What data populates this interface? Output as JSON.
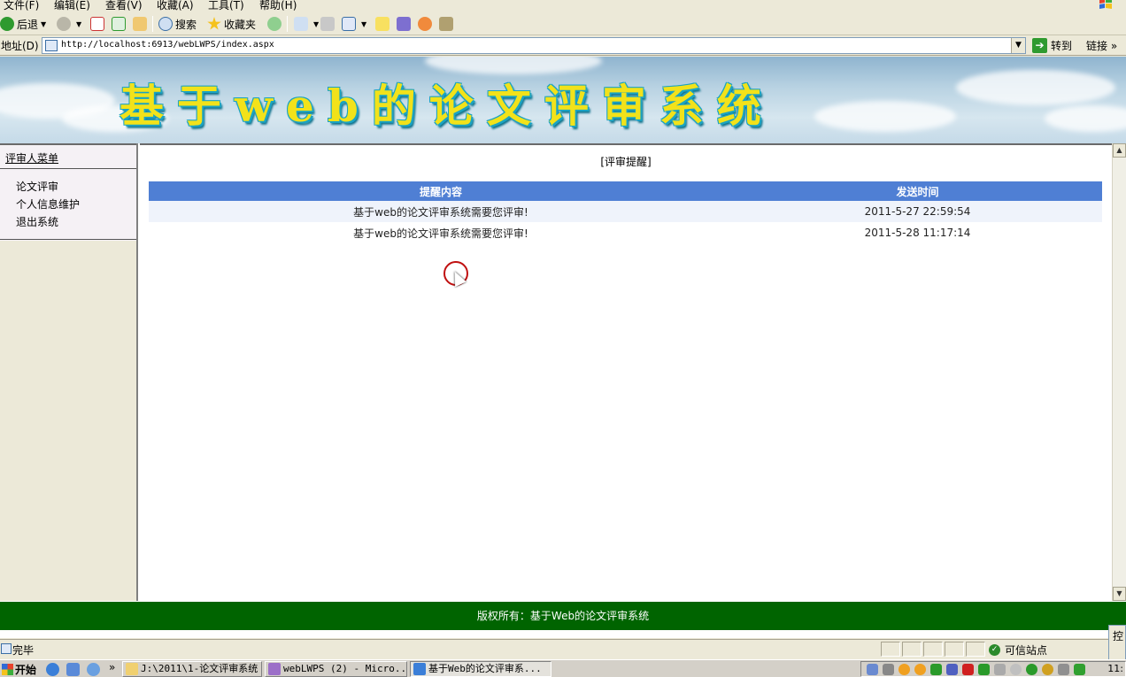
{
  "browser": {
    "menu": [
      "文件(F)",
      "编辑(E)",
      "查看(V)",
      "收藏(A)",
      "工具(T)",
      "帮助(H)"
    ],
    "toolbar": {
      "back_label": "后退",
      "search_label": "搜索",
      "favorites_label": "收藏夹"
    },
    "address": {
      "label": "地址(D)",
      "url": "http://localhost:6913/webLWPS/index.aspx",
      "go_label": "转到",
      "links_label": "链接"
    },
    "status": {
      "text": "完毕",
      "zone": "可信站点",
      "side_tab": "控"
    }
  },
  "page": {
    "banner_title": "基于web的论文评审系统",
    "sidebar": {
      "heading": "评审人菜单",
      "items": [
        {
          "label": "论文评审"
        },
        {
          "label": "个人信息维护"
        },
        {
          "label": "退出系统"
        }
      ]
    },
    "content": {
      "title": "[评审提醒]",
      "table": {
        "headers": [
          "提醒内容",
          "发送时间"
        ],
        "rows": [
          {
            "content": "基于web的论文评审系统需要您评审!",
            "time": "2011-5-27 22:59:54"
          },
          {
            "content": "基于web的论文评审系统需要您评审!",
            "time": "2011-5-28 11:17:14"
          }
        ]
      }
    },
    "footer": "版权所有：基于Web的论文评审系统"
  },
  "taskbar": {
    "start_label": "开始",
    "tasks": [
      {
        "label": "J:\\2011\\1-论文评审系统"
      },
      {
        "label": "webLWPS (2) - Micro..."
      },
      {
        "label": "基于Web的论文评审系..."
      }
    ],
    "clock": "11:"
  },
  "colors": {
    "table_header": "#4f7fd4",
    "footer_bg": "#006400",
    "title_fill": "#f2e21a",
    "title_outline": "#1aa3c2"
  }
}
